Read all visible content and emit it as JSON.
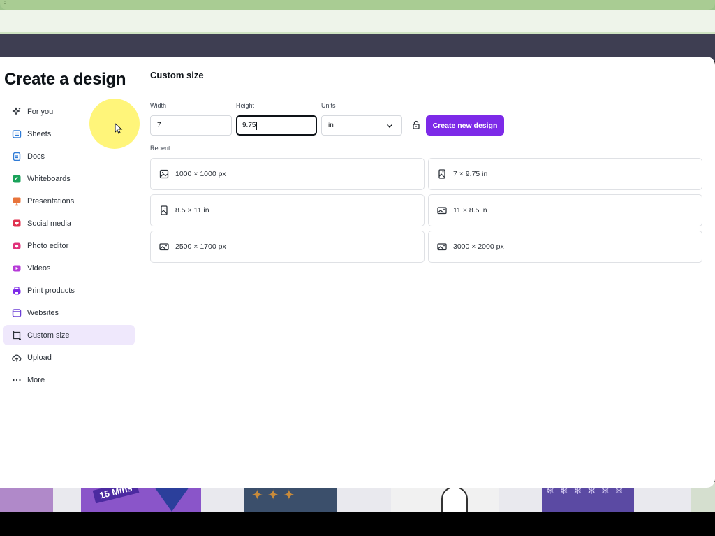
{
  "browser": {
    "dots": "⋮"
  },
  "modal": {
    "title": "Create a design",
    "nav": [
      {
        "label": "For you",
        "icon": "sparkle-icon",
        "color": "#2c323a"
      },
      {
        "label": "Sheets",
        "icon": "sheets-icon",
        "color": "#2f7bd6"
      },
      {
        "label": "Docs",
        "icon": "docs-icon",
        "color": "#2f7bd6"
      },
      {
        "label": "Whiteboards",
        "icon": "whiteboard-icon",
        "color": "#1aa25a"
      },
      {
        "label": "Presentations",
        "icon": "presentation-icon",
        "color": "#e8743b"
      },
      {
        "label": "Social media",
        "icon": "heart-icon",
        "color": "#e0324f"
      },
      {
        "label": "Photo editor",
        "icon": "camera-icon",
        "color": "#e0327a"
      },
      {
        "label": "Videos",
        "icon": "video-icon",
        "color": "#b63ad8"
      },
      {
        "label": "Print products",
        "icon": "printer-icon",
        "color": "#7d2ae8"
      },
      {
        "label": "Websites",
        "icon": "website-icon",
        "color": "#6b3fd6"
      },
      {
        "label": "Custom size",
        "icon": "custom-size-icon",
        "color": "#2c323a",
        "active": true
      },
      {
        "label": "Upload",
        "icon": "cloud-upload-icon",
        "color": "#2c323a"
      },
      {
        "label": "More",
        "icon": "more-icon",
        "color": "#2c323a"
      }
    ],
    "panel_title": "Custom size",
    "width": {
      "label": "Width",
      "value": "7"
    },
    "height": {
      "label": "Height",
      "value": "9.75"
    },
    "units": {
      "label": "Units",
      "value": "in"
    },
    "create_button": "Create new design",
    "recent_label": "Recent",
    "recent": [
      {
        "label": "1000 × 1000 px",
        "icon": "image-icon"
      },
      {
        "label": "7 × 9.75 in",
        "icon": "portrait-image-icon"
      },
      {
        "label": "8.5 × 11 in",
        "icon": "portrait-image-icon"
      },
      {
        "label": "11 × 8.5 in",
        "icon": "landscape-image-icon"
      },
      {
        "label": "2500 × 1700 px",
        "icon": "landscape-image-icon"
      },
      {
        "label": "3000 × 2000 px",
        "icon": "landscape-image-icon"
      }
    ],
    "accent_color": "#7d2ae8"
  },
  "background_thumbs": {
    "tag_text": "15 Mins"
  }
}
